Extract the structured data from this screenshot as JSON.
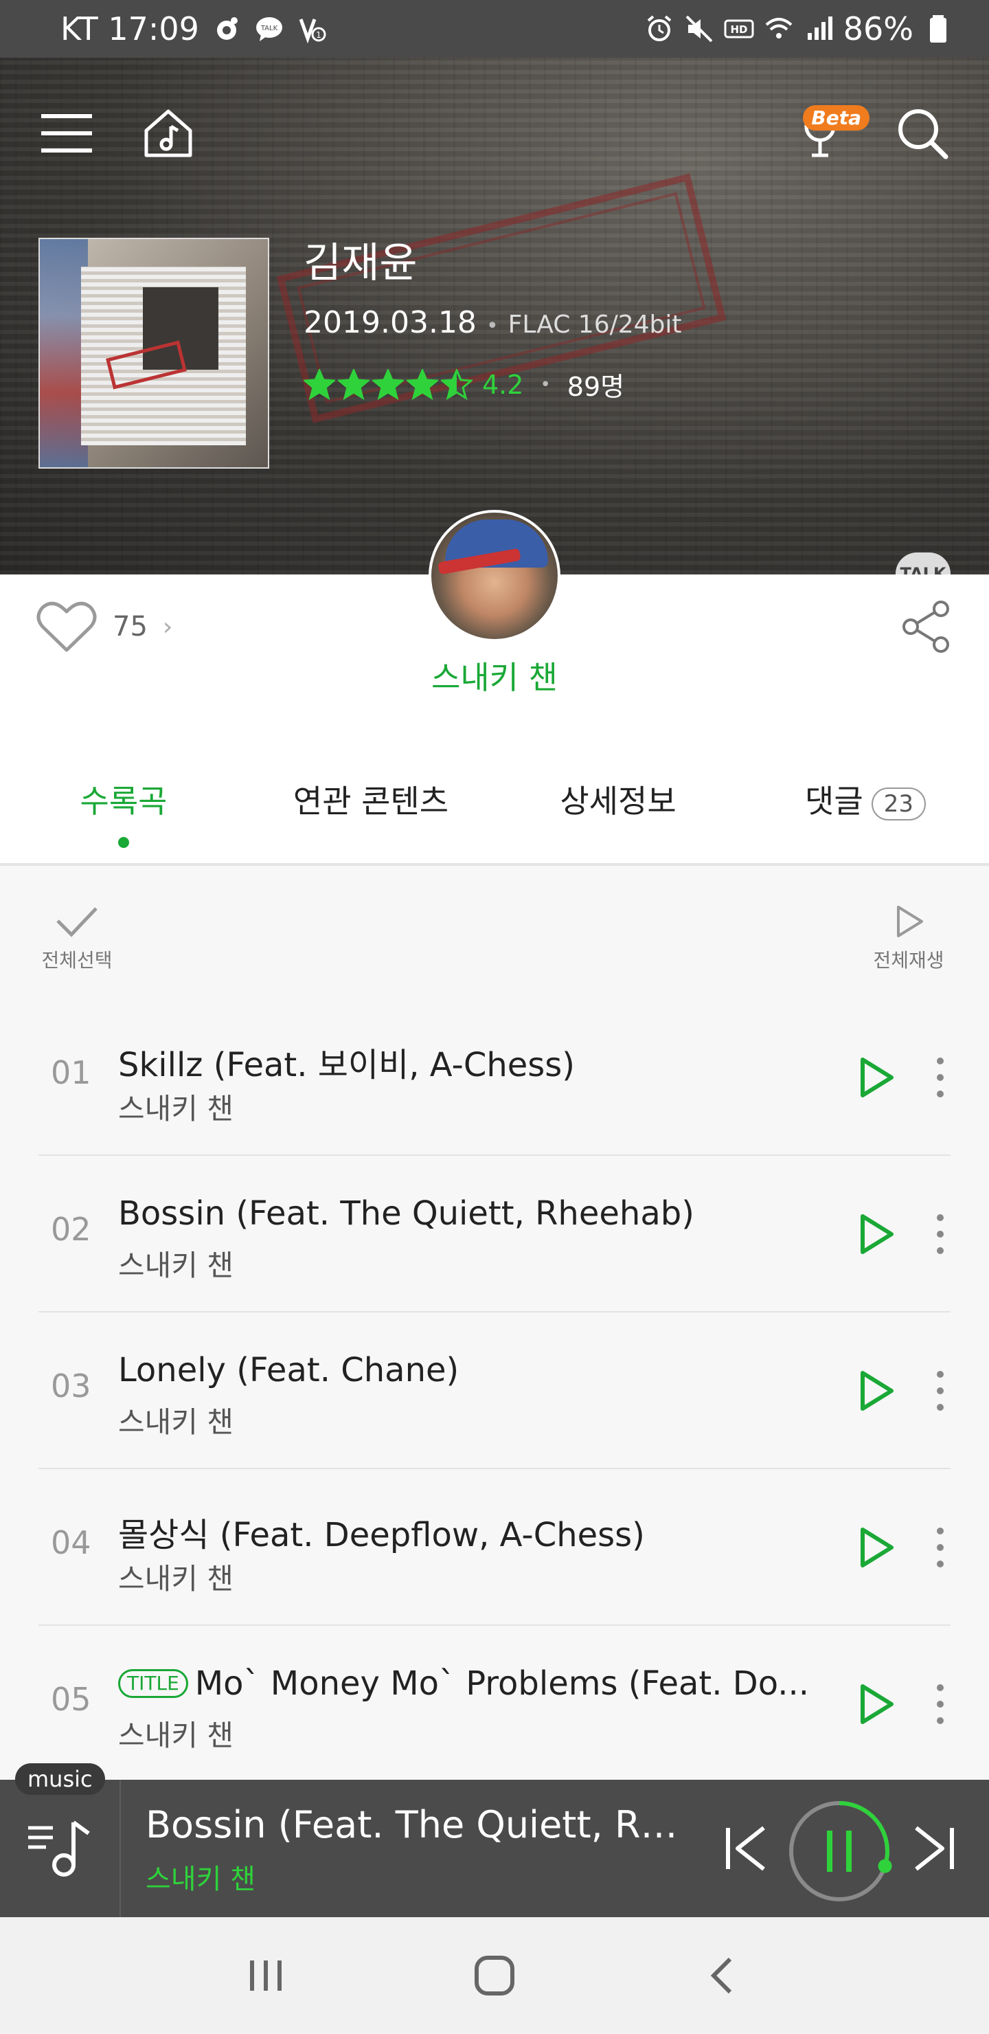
{
  "status_bar": {
    "carrier_time": "KT 17:09",
    "battery": "86%"
  },
  "header": {
    "beta_label": "Beta",
    "talk_label": "TALK"
  },
  "album": {
    "title": "김재윤",
    "date": "2019.03.18",
    "format": "FLAC 16/24bit",
    "rating": "4.2",
    "rating_count": "89명",
    "stars_filled": 4.5
  },
  "social": {
    "likes": "75",
    "artist_name": "스내키 챈"
  },
  "tabs": [
    {
      "label": "수록곡",
      "active": true
    },
    {
      "label": "연관 콘텐츠",
      "active": false
    },
    {
      "label": "상세정보",
      "active": false
    },
    {
      "label": "댓글",
      "active": false,
      "badge": "23"
    }
  ],
  "list_controls": {
    "select_all": "전체선택",
    "play_all": "전체재생"
  },
  "tracks": [
    {
      "num": "01",
      "title": "Skillz (Feat. 보이비, A-Chess)",
      "artist": "스내키 챈",
      "badge": ""
    },
    {
      "num": "02",
      "title": "Bossin (Feat. The Quiett, Rheehab)",
      "artist": "스내키 챈",
      "badge": ""
    },
    {
      "num": "03",
      "title": "Lonely (Feat. Chane)",
      "artist": "스내키 챈",
      "badge": ""
    },
    {
      "num": "04",
      "title": "몰상식 (Feat. Deepflow, A-Chess)",
      "artist": "스내키 챈",
      "badge": ""
    },
    {
      "num": "05",
      "title": "Mo` Money Mo` Problems (Feat. Do...",
      "artist": "스내키 챈",
      "badge": "TITLE"
    }
  ],
  "music_badge": "music",
  "player": {
    "title": "Bossin (Feat. The Quiett, Rh...",
    "artist": "스내키 챈",
    "progress": 0.3
  },
  "colors": {
    "accent": "#1aa836",
    "accent_bright": "#2fd23b",
    "beta": "#f07c1e",
    "player_bg": "#4b4b4b"
  }
}
